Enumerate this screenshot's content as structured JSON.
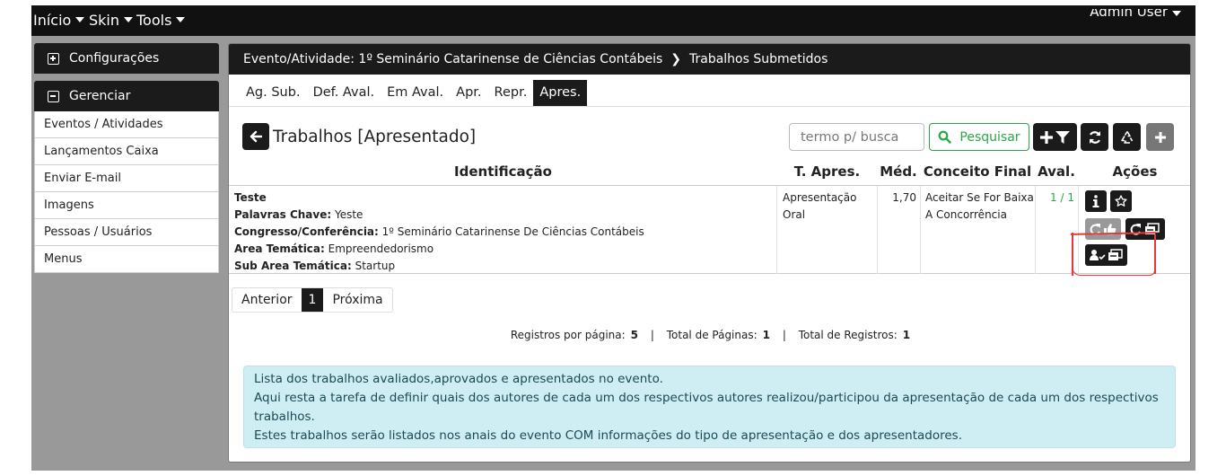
{
  "navbar": {
    "items": [
      "Início",
      "Skin",
      "Tools"
    ],
    "user": "Admin User"
  },
  "sidebar": {
    "config_title": "Configurações",
    "manage_title": "Gerenciar",
    "items": [
      "Eventos / Atividades",
      "Lançamentos Caixa",
      "Enviar E-mail",
      "Imagens",
      "Pessoas / Usuários",
      "Menus"
    ]
  },
  "breadcrumb": {
    "event": "Evento/Atividade: 1º Seminário Catarinense de Ciências Contábeis",
    "page": "Trabalhos Submetidos"
  },
  "tabs": [
    "Ag. Sub.",
    "Def. Aval.",
    "Em Aval.",
    "Apr.",
    "Repr.",
    "Apres."
  ],
  "active_tab": "Apres.",
  "title": "Trabalhos [Apresentado]",
  "search": {
    "placeholder": "termo p/ busca",
    "button": "Pesquisar"
  },
  "table": {
    "headers": [
      "Identificação",
      "T. Apres.",
      "Méd.",
      "Conceito Final",
      "Aval.",
      "Ações"
    ],
    "rows": [
      {
        "title": "Teste",
        "keywords_label": "Palavras Chave:",
        "keywords": "Yeste",
        "congress_label": "Congresso/Conferência:",
        "congress": "1º Seminário Catarinense De Ciências Contábeis",
        "area_label": "Area Temática:",
        "area": "Empreendedorismo",
        "subarea_label": "Sub Area Temática:",
        "subarea": "Startup",
        "tipo_line1": "Apresentação",
        "tipo_line2": "Oral",
        "media": "1,70",
        "conceito_line1": "Aceitar Se For Baixa",
        "conceito_line2": "A Concorrência",
        "aval": "1 / 1"
      }
    ]
  },
  "pagination": {
    "prev": "Anterior",
    "current": "1",
    "next": "Próxima"
  },
  "registros": {
    "per_page_label": "Registros por página:",
    "per_page": "5",
    "pages_label": "Total de Páginas:",
    "pages": "1",
    "total_label": "Total de Registros:",
    "total": "1",
    "separator": "|"
  },
  "info": {
    "line1": "Lista dos trabalhos avaliados,aprovados e apresentados no evento.",
    "line2": "Aqui resta a tarefa de definir quais dos autores de cada um dos respectivos autores realizou/participou da apresentação de cada um dos respectivos trabalhos.",
    "line3": "Estes trabalhos serão listados nos anais do evento COM informações do tipo de apresentação e dos apresentadores."
  },
  "colors": {
    "dark": "#1b1b1b",
    "green": "#28a745",
    "info_bg": "#cfeef3",
    "annotation_red": "#e53935"
  }
}
